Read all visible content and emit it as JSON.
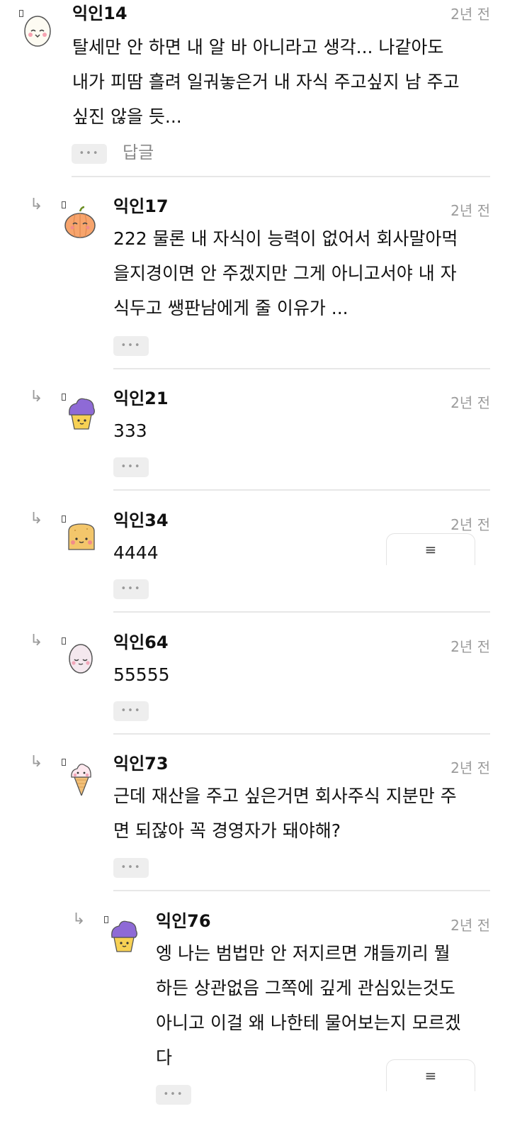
{
  "comments": [
    {
      "author": "익인14",
      "time": "2년 전",
      "lines": [
        "탈세만 안 하면 내 알 바 아니라고 생각... 나같아도",
        "내가 피땀 흘려 일궈놓은거 내 자식 주고싶지 남 주고",
        "싶진 않을 듯..."
      ],
      "more": "•••",
      "reply_label": "답글",
      "avatar": "egg-face-icon"
    },
    {
      "author": "익인17",
      "time": "2년 전",
      "lines": [
        "222 물론 내 자식이 능력이 없어서 회사말아먹",
        "을지경이면 안 주겠지만 그게 아니고서야 내 자",
        "식두고 쌩판남에게 줄 이유가 ..."
      ],
      "more": "•••",
      "avatar": "pumpkin-icon"
    },
    {
      "author": "익인21",
      "time": "2년 전",
      "lines": [
        "333"
      ],
      "more": "•••",
      "avatar": "purple-cupcake-icon"
    },
    {
      "author": "익인34",
      "time": "2년 전",
      "lines": [
        "4444"
      ],
      "more": "•••",
      "avatar": "toast-icon"
    },
    {
      "author": "익인64",
      "time": "2년 전",
      "lines": [
        "55555"
      ],
      "more": "•••",
      "avatar": "egg-sleepy-icon"
    },
    {
      "author": "익인73",
      "time": "2년 전",
      "lines": [
        "근데 재산을 주고 싶은거면 회사주식 지분만 주",
        "면 되잖아 꼭 경영자가 돼야해?"
      ],
      "more": "•••",
      "avatar": "ice-cream-cone-icon"
    },
    {
      "author": "익인76",
      "time": "2년 전",
      "lines": [
        "엥 나는 범법만 안 저지르면 걔들끼리 뭘",
        "하든 상관없음 그쪽에 깊게 관심있는것도",
        "아니고 이걸 왜 나한테 물어보는지 모르겠",
        "다"
      ],
      "more": "•••",
      "avatar": "purple-cupcake-icon"
    }
  ],
  "reply_arrow": "↳",
  "floating_menu_icon": "≡",
  "colors": {
    "divider": "#e7e7e7",
    "time": "#9b9b9b",
    "button_bg": "#eeeeee"
  }
}
